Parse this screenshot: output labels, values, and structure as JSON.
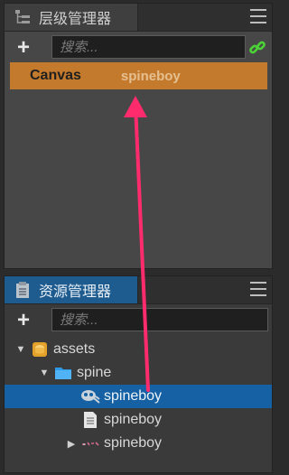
{
  "hierarchy": {
    "tab_title": "层级管理器",
    "search_placeholder": "搜索...",
    "nodes": [
      {
        "label": "Canvas"
      }
    ],
    "drag_ghost_label": "spineboy"
  },
  "assets": {
    "tab_title": "资源管理器",
    "search_placeholder": "搜索...",
    "tree": [
      {
        "label": "assets",
        "icon": "database-icon"
      },
      {
        "label": "spine",
        "icon": "folder-icon"
      },
      {
        "label": "spineboy",
        "icon": "skeleton-icon"
      },
      {
        "label": "spineboy",
        "icon": "file-icon"
      },
      {
        "label": "spineboy",
        "icon": "atlas-icon"
      }
    ]
  },
  "colors": {
    "selection": "#1561a3",
    "canvas_highlight": "#c47a2c",
    "drag_arrow": "#ff2b6d",
    "link_icon": "#4cd137"
  }
}
